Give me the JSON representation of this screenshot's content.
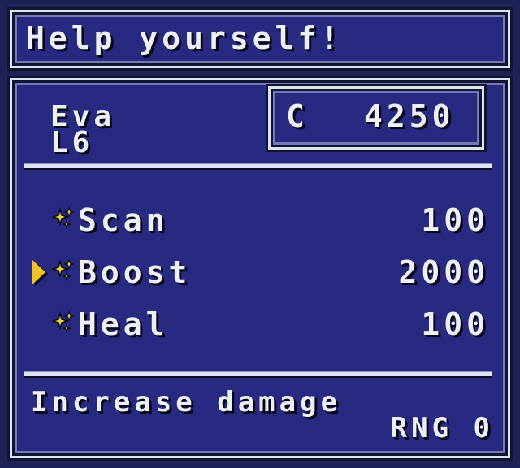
{
  "title": "Help yourself!",
  "character": {
    "name": "Eva",
    "level": "L6"
  },
  "currency": {
    "label": "C",
    "amount": "4250"
  },
  "items": [
    {
      "name": "Scan",
      "cost": "100",
      "icon": "sparkle-icon",
      "selected": false
    },
    {
      "name": "Boost",
      "cost": "2000",
      "icon": "sparkle-icon",
      "selected": true
    },
    {
      "name": "Heal",
      "cost": "100",
      "icon": "sparkle-icon",
      "selected": false
    }
  ],
  "description": {
    "text": "Increase damage",
    "stat": "RNG 0"
  },
  "colors": {
    "panel": "#272a80",
    "border": "#dfe1ee",
    "text": "#eef0f6",
    "cursor": "#f2c423",
    "icon": "#f2d23a"
  }
}
